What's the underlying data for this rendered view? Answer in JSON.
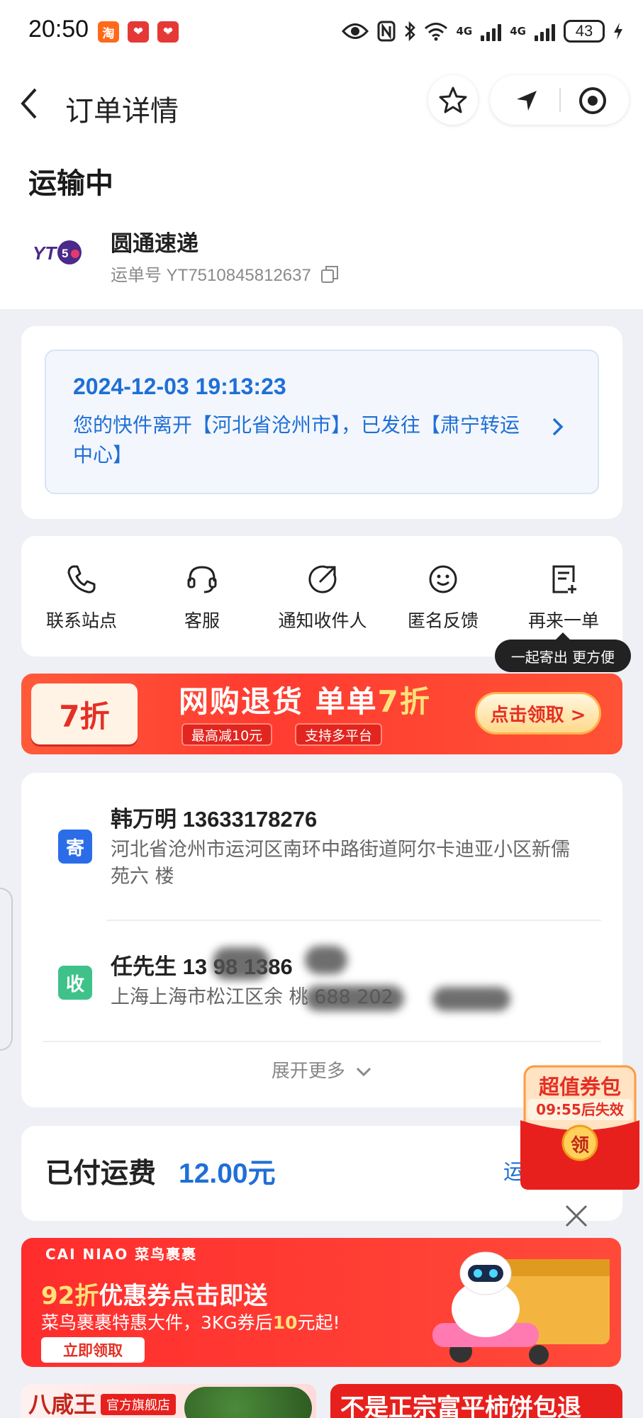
{
  "status_bar": {
    "time": "20:50",
    "battery": "43",
    "net1": "4G",
    "net2": "4G"
  },
  "nav": {
    "title": "订单详情"
  },
  "shipment": {
    "status": "运输中",
    "carrier_name": "圆通速递",
    "waybill_label": "运单号 YT7510845812637"
  },
  "tracking": {
    "datetime": "2024-12-03 19:13:23",
    "message": "您的快件离开【河北省沧州市】，已发往【肃宁转运中心】"
  },
  "actions": [
    {
      "label": "联系站点",
      "icon": "phone-icon"
    },
    {
      "label": "客服",
      "icon": "headset-icon"
    },
    {
      "label": "通知收件人",
      "icon": "share-arrow-icon"
    },
    {
      "label": "匿名反馈",
      "icon": "smile-icon"
    },
    {
      "label": "再来一单",
      "icon": "note-add-icon"
    }
  ],
  "tooltip": "一起寄出 更方便",
  "banner1": {
    "tag": "7折",
    "title_a": "网购退货 单单",
    "title_b": "7折",
    "pill1": "最高减10元",
    "pill2": "支持多平台",
    "button": "点击领取 >"
  },
  "sender": {
    "badge": "寄",
    "name_phone": "韩万明 13633178276",
    "address": "河北省沧州市运河区南环中路街道阿尔卡迪亚小区新儒苑六  楼"
  },
  "receiver": {
    "badge": "收",
    "name_phone": "任先生 13 98 1386",
    "address": "上海上海市松江区余   桃   688    202"
  },
  "expand_label": "展开更多",
  "fee": {
    "label": "已付运费",
    "value": "12.00元",
    "link": "运"
  },
  "coupon_float": {
    "title": "超值券包",
    "timer": "09:55后失效",
    "button": "领"
  },
  "banner2": {
    "logo": "CAI NIAO 菜鸟裹裹",
    "title_a": "92折",
    "title_b": "优惠券点击即送",
    "sub_a": "菜鸟裹裹特惠大件，3KG券后",
    "sub_b": "10",
    "sub_c": "元起!",
    "button": "立即领取"
  },
  "bottom": {
    "left_brand": "八咸王",
    "left_tag": "官方旗舰店",
    "right_title": "不是正宗富平柿饼包退"
  },
  "colors": {
    "primary_blue": "#1f6fd6",
    "sender_badge": "#2b6de8",
    "receiver_badge": "#3fc28a",
    "promo_red": "#ff3b30"
  }
}
